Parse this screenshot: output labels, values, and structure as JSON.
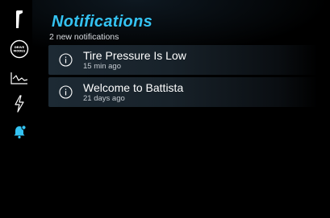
{
  "sidebar": {
    "items": [
      {
        "icon": "car-logo-icon",
        "label": ""
      },
      {
        "icon": "drive-modes-icon",
        "label": "DRIVE MODES"
      },
      {
        "icon": "performance-chart-icon",
        "label": ""
      },
      {
        "icon": "lightning-bolt-icon",
        "label": ""
      },
      {
        "icon": "notifications-bell-icon",
        "label": "",
        "active": true
      }
    ],
    "active_color": "#34c3f2"
  },
  "header": {
    "title": "Notifications",
    "subtitle": "2 new notifications"
  },
  "notifications": [
    {
      "icon": "info-icon",
      "title": "Tire Pressure Is Low",
      "time": "15 min ago"
    },
    {
      "icon": "info-icon",
      "title": "Welcome to Battista",
      "time": "21 days ago"
    }
  ],
  "colors": {
    "accent": "#34c3f2",
    "background": "#000000",
    "card": "#1d2a34"
  }
}
